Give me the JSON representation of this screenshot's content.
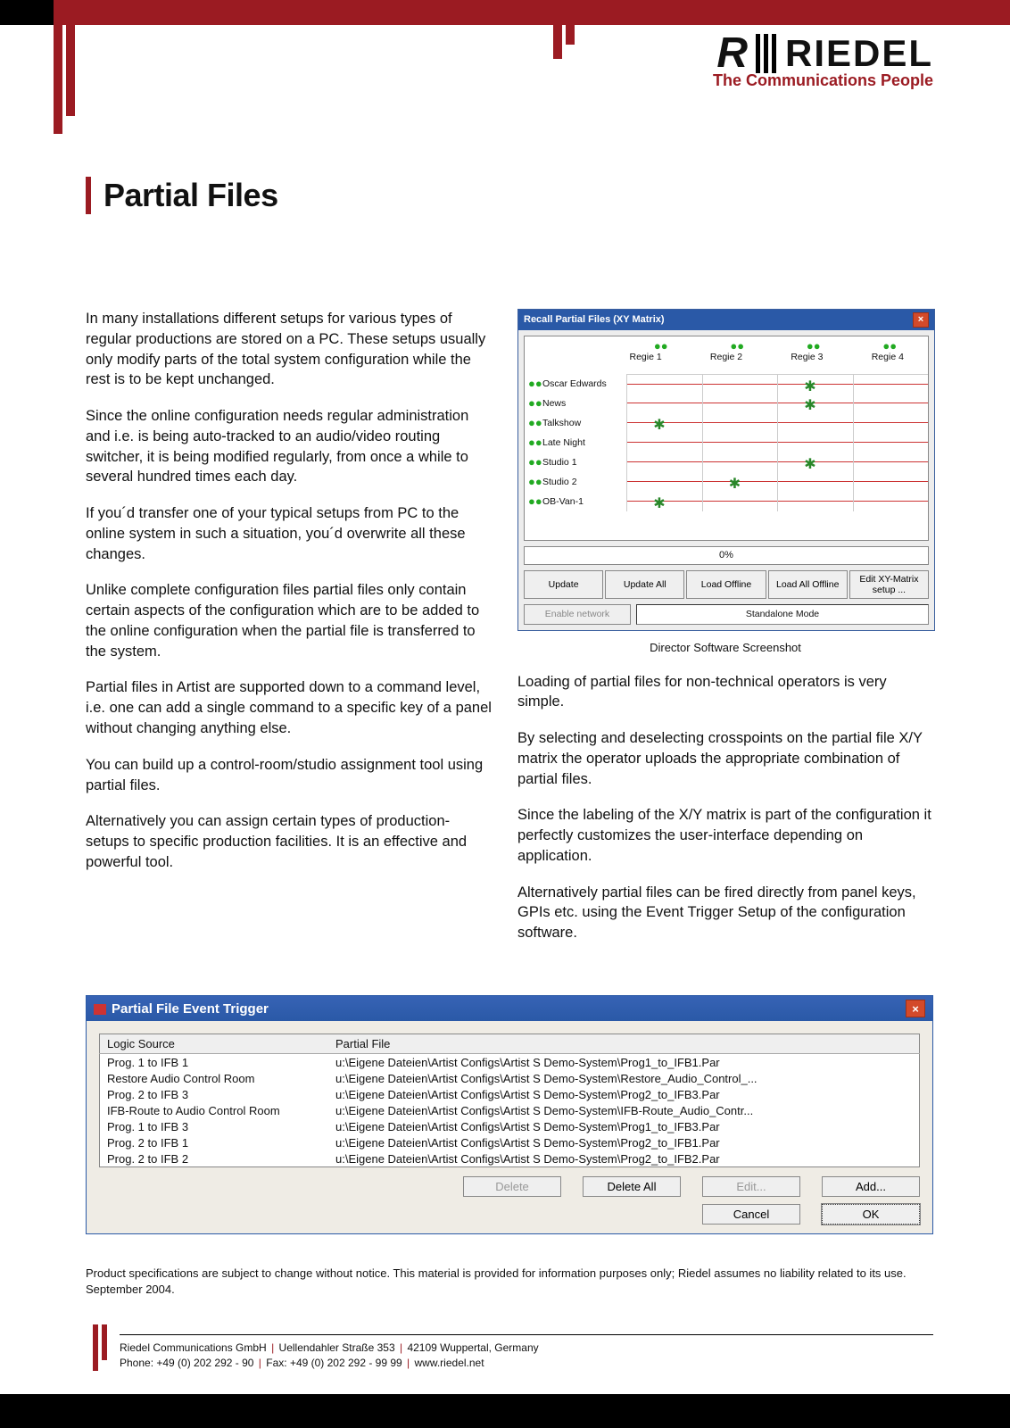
{
  "brand": {
    "r": "R",
    "name": "RIEDEL",
    "tagline": "The Communications People"
  },
  "title": "Partial Files",
  "colLeft": [
    "In many installations different setups for various types of regular productions are stored on a PC. These setups usually only modify parts of the total system configuration while the rest is to be kept unchanged.",
    "Since the online configuration needs regular administration and i.e. is being auto-tracked to an audio/video routing switcher, it is being modified regularly, from once a while to several hundred times each day.",
    "If you´d transfer one of your typical setups from PC to the online system in such a situation, you´d overwrite all these changes.",
    "Unlike complete configuration files partial files only contain certain aspects of the configuration which are to be added to the online configuration when the partial file is transferred to the system.",
    "Partial files in Artist are supported down to a command level, i.e. one can add a single command to a specific key of a panel without changing anything else.",
    "You can build up a control-room/studio assignment tool using partial files.",
    "Alternatively you can assign certain types of production-setups to specific production facilities. It is an effective and powerful tool."
  ],
  "colRight": [
    "Loading of partial files for non-technical operators is very simple.",
    "By selecting and deselecting crosspoints on the partial file X/Y matrix the operator uploads the appropriate combination of partial files.",
    "Since the labeling of the X/Y matrix is part of the configuration it perfectly customizes the user-interface depending on application.",
    "Alternatively partial files can be fired directly from panel keys, GPIs etc. using the Event Trigger Setup of the configuration software."
  ],
  "ss1": {
    "title": "Recall Partial Files (XY Matrix)",
    "cols": [
      "Regie 1",
      "Regie 2",
      "Regie 3",
      "Regie 4"
    ],
    "rows": [
      "Oscar Edwards",
      "News",
      "Talkshow",
      "Late Night",
      "Studio 1",
      "Studio 2",
      "OB-Van-1"
    ],
    "sel": [
      [
        0,
        2
      ],
      [
        1,
        2
      ],
      [
        2,
        0
      ],
      [
        4,
        2
      ],
      [
        5,
        1
      ],
      [
        6,
        0
      ]
    ],
    "progress": "0%",
    "buttons": [
      "Update",
      "Update All",
      "Load Offline",
      "Load All Offline",
      "Edit XY-Matrix setup ..."
    ],
    "enable": "Enable network",
    "standalone": "Standalone Mode",
    "caption": "Director Software Screenshot"
  },
  "ss2": {
    "title": "Partial File Event Trigger",
    "headers": [
      "Logic Source",
      "Partial File"
    ],
    "rows": [
      [
        "Prog. 1 to IFB 1",
        "u:\\Eigene Dateien\\Artist Configs\\Artist S Demo-System\\Prog1_to_IFB1.Par"
      ],
      [
        "Restore Audio Control Room",
        "u:\\Eigene Dateien\\Artist Configs\\Artist S Demo-System\\Restore_Audio_Control_..."
      ],
      [
        "Prog. 2 to IFB 3",
        "u:\\Eigene Dateien\\Artist Configs\\Artist S Demo-System\\Prog2_to_IFB3.Par"
      ],
      [
        "IFB-Route to Audio Control Room",
        "u:\\Eigene Dateien\\Artist Configs\\Artist S Demo-System\\IFB-Route_Audio_Contr..."
      ],
      [
        "Prog. 1 to IFB 3",
        "u:\\Eigene Dateien\\Artist Configs\\Artist S Demo-System\\Prog1_to_IFB3.Par"
      ],
      [
        "Prog. 2 to IFB 1",
        "u:\\Eigene Dateien\\Artist Configs\\Artist S Demo-System\\Prog2_to_IFB1.Par"
      ],
      [
        "Prog. 2 to IFB 2",
        "u:\\Eigene Dateien\\Artist Configs\\Artist S Demo-System\\Prog2_to_IFB2.Par"
      ]
    ],
    "btns1": [
      "Delete",
      "Delete All",
      "Edit...",
      "Add..."
    ],
    "btns2": [
      "Cancel",
      "OK"
    ]
  },
  "disclaimer": "Product specifications are subject to change without notice. This material is provided for information purposes only; Riedel assumes no liability related to its use. September 2004.",
  "footer": {
    "l1a": "Riedel Communications GmbH",
    "l1b": "Uellendahler Straße 353",
    "l1c": "42109 Wuppertal, Germany",
    "l2a": "Phone: +49 (0) 202 292 - 90",
    "l2b": "Fax: +49 (0) 202 292 - 99 99",
    "l2c": "www.riedel.net"
  }
}
